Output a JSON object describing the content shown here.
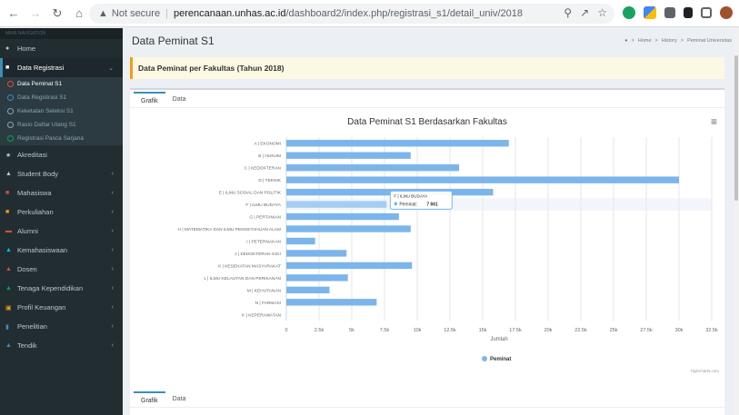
{
  "browser": {
    "not_secure": "Not secure",
    "host": "perencanaan.unhas.ac.id",
    "path": "/dashboard2/index.php/registrasi_s1/detail_univ/2018"
  },
  "sidebar": {
    "header": "MAIN NAVIGATION",
    "items": [
      {
        "label": "Home",
        "icon": "home-icon"
      },
      {
        "label": "Data Registrasi",
        "icon": "list-icon"
      },
      {
        "label": "Akreditasi",
        "icon": "star-icon"
      },
      {
        "label": "Student Body",
        "icon": "users-icon"
      },
      {
        "label": "Mahasiswa",
        "icon": "user-icon"
      },
      {
        "label": "Perkuliahan",
        "icon": "book-icon"
      },
      {
        "label": "Alumni",
        "icon": "grad-icon"
      },
      {
        "label": "Kemahasiswaan",
        "icon": "person-icon"
      },
      {
        "label": "Dosen",
        "icon": "teacher-icon"
      },
      {
        "label": "Tenaga Kependidikan",
        "icon": "staff-icon"
      },
      {
        "label": "Profil Keuangan",
        "icon": "money-icon"
      },
      {
        "label": "Penelitian",
        "icon": "bar-icon"
      },
      {
        "label": "Tendik",
        "icon": "staff-icon"
      }
    ],
    "sub_items": [
      "Data Peminat S1",
      "Data Registrasi S1",
      "Keketatan Seleksi S1",
      "Rasio Daftar Ulang S1",
      "Registrasi Pasca Sarjana"
    ]
  },
  "content": {
    "title": "Data Peminat S1",
    "breadcrumb": [
      "Home",
      "History",
      "Peminat Universitas"
    ],
    "callout": "Data Peminat per Fakultas (Tahun 2018)",
    "tabs": [
      "Grafik",
      "Data"
    ],
    "tabs2": [
      "Grafik",
      "Data"
    ]
  },
  "chart_data": {
    "type": "bar",
    "orientation": "horizontal",
    "title": "Data Peminat S1 Berdasarkan Fakultas",
    "xlabel": "Jumlah",
    "xlim": [
      0,
      32500
    ],
    "xticks": [
      0,
      2500,
      5000,
      7500,
      10000,
      12500,
      15000,
      17500,
      20000,
      22500,
      25000,
      27500,
      30000,
      32500
    ],
    "xtick_labels": [
      "0",
      "2.5k",
      "5k",
      "7.5k",
      "10k",
      "12.5k",
      "15k",
      "17.5k",
      "20k",
      "22.5k",
      "25k",
      "27.5k",
      "30k",
      "32.5k"
    ],
    "categories": [
      "A | EKONOMI",
      "B | HUKUM",
      "C | KEDOKTERAN",
      "D | TEKNIK",
      "E | ILMU SOSIAL DAN POLITIK",
      "F | ILMU BUDAYA",
      "G | PERTANIAN",
      "H | MATEMATIKA DAN ILMU PENGETAHUAN ALAM",
      "I | PETERNAKAN",
      "J | KEDOKTERAN GIGI",
      "K | KESEHATAN MASYARAKAT",
      "L | ILMU KELAUTAN DAN PERIKANAN",
      "M | KEHUTANAN",
      "N | FARMASI",
      "K | KEPERAWATAN"
    ],
    "series": [
      {
        "name": "Peminat",
        "color": "#7cb5ec",
        "values": [
          17000,
          9500,
          13200,
          30000,
          15800,
          7661,
          8600,
          9500,
          2200,
          4600,
          9600,
          4700,
          3300,
          6900,
          0
        ]
      }
    ],
    "tooltip": {
      "label": "F | ILMU BUDAYA",
      "series": "Peminat",
      "value": "7 661"
    },
    "credits": "Highcharts.com"
  }
}
